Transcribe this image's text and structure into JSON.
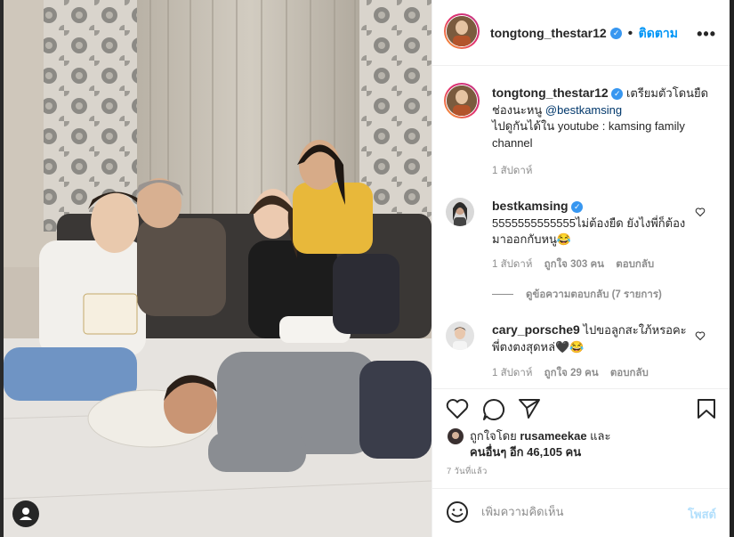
{
  "post": {
    "username": "tongtong_thestar12",
    "follow_label": "ติดตาม",
    "more_icon": "more-options-icon"
  },
  "caption": {
    "username": "tongtong_thestar12",
    "text_before": "เตรียมตัวโดนยืดช่องนะหนู ",
    "mention": "@bestkamsing",
    "text_after": "ไปดูกันได้ใน youtube : kamsing family channel",
    "time": "1 สัปดาห์"
  },
  "comments": [
    {
      "username": "bestkamsing",
      "text": "5555555555555ไม่ต้องยืด ยังไงพี่ก็ต้องมาออกกับหนู😂",
      "time": "1 สัปดาห์",
      "likes": "ถูกใจ 303 คน",
      "reply": "ตอบกลับ",
      "view_replies": "ดูข้อความตอบกลับ (7 รายการ)"
    },
    {
      "username": "cary_porsche9",
      "text": "ไปขอลูกสะใภ้หรอคะพี่ตงตงสุดหล่🖤😂",
      "time": "1 สัปดาห์",
      "likes": "ถูกใจ 29 คน",
      "reply": "ตอบกลับ"
    }
  ],
  "likes": {
    "liked_by_prefix": "ถูกใจโดย ",
    "liked_by_user": "rusameekae",
    "and": " และ",
    "others": "คนอื่นๆ อีก 46,105 คน"
  },
  "timestamp": "7 วันที่แล้ว",
  "add_comment": {
    "placeholder": "เพิ่มความคิดเห็น",
    "post_label": "โพสต์"
  },
  "colors": {
    "link": "#0095f6",
    "verified": "#3897f0",
    "post_disabled": "#b2dffc"
  }
}
